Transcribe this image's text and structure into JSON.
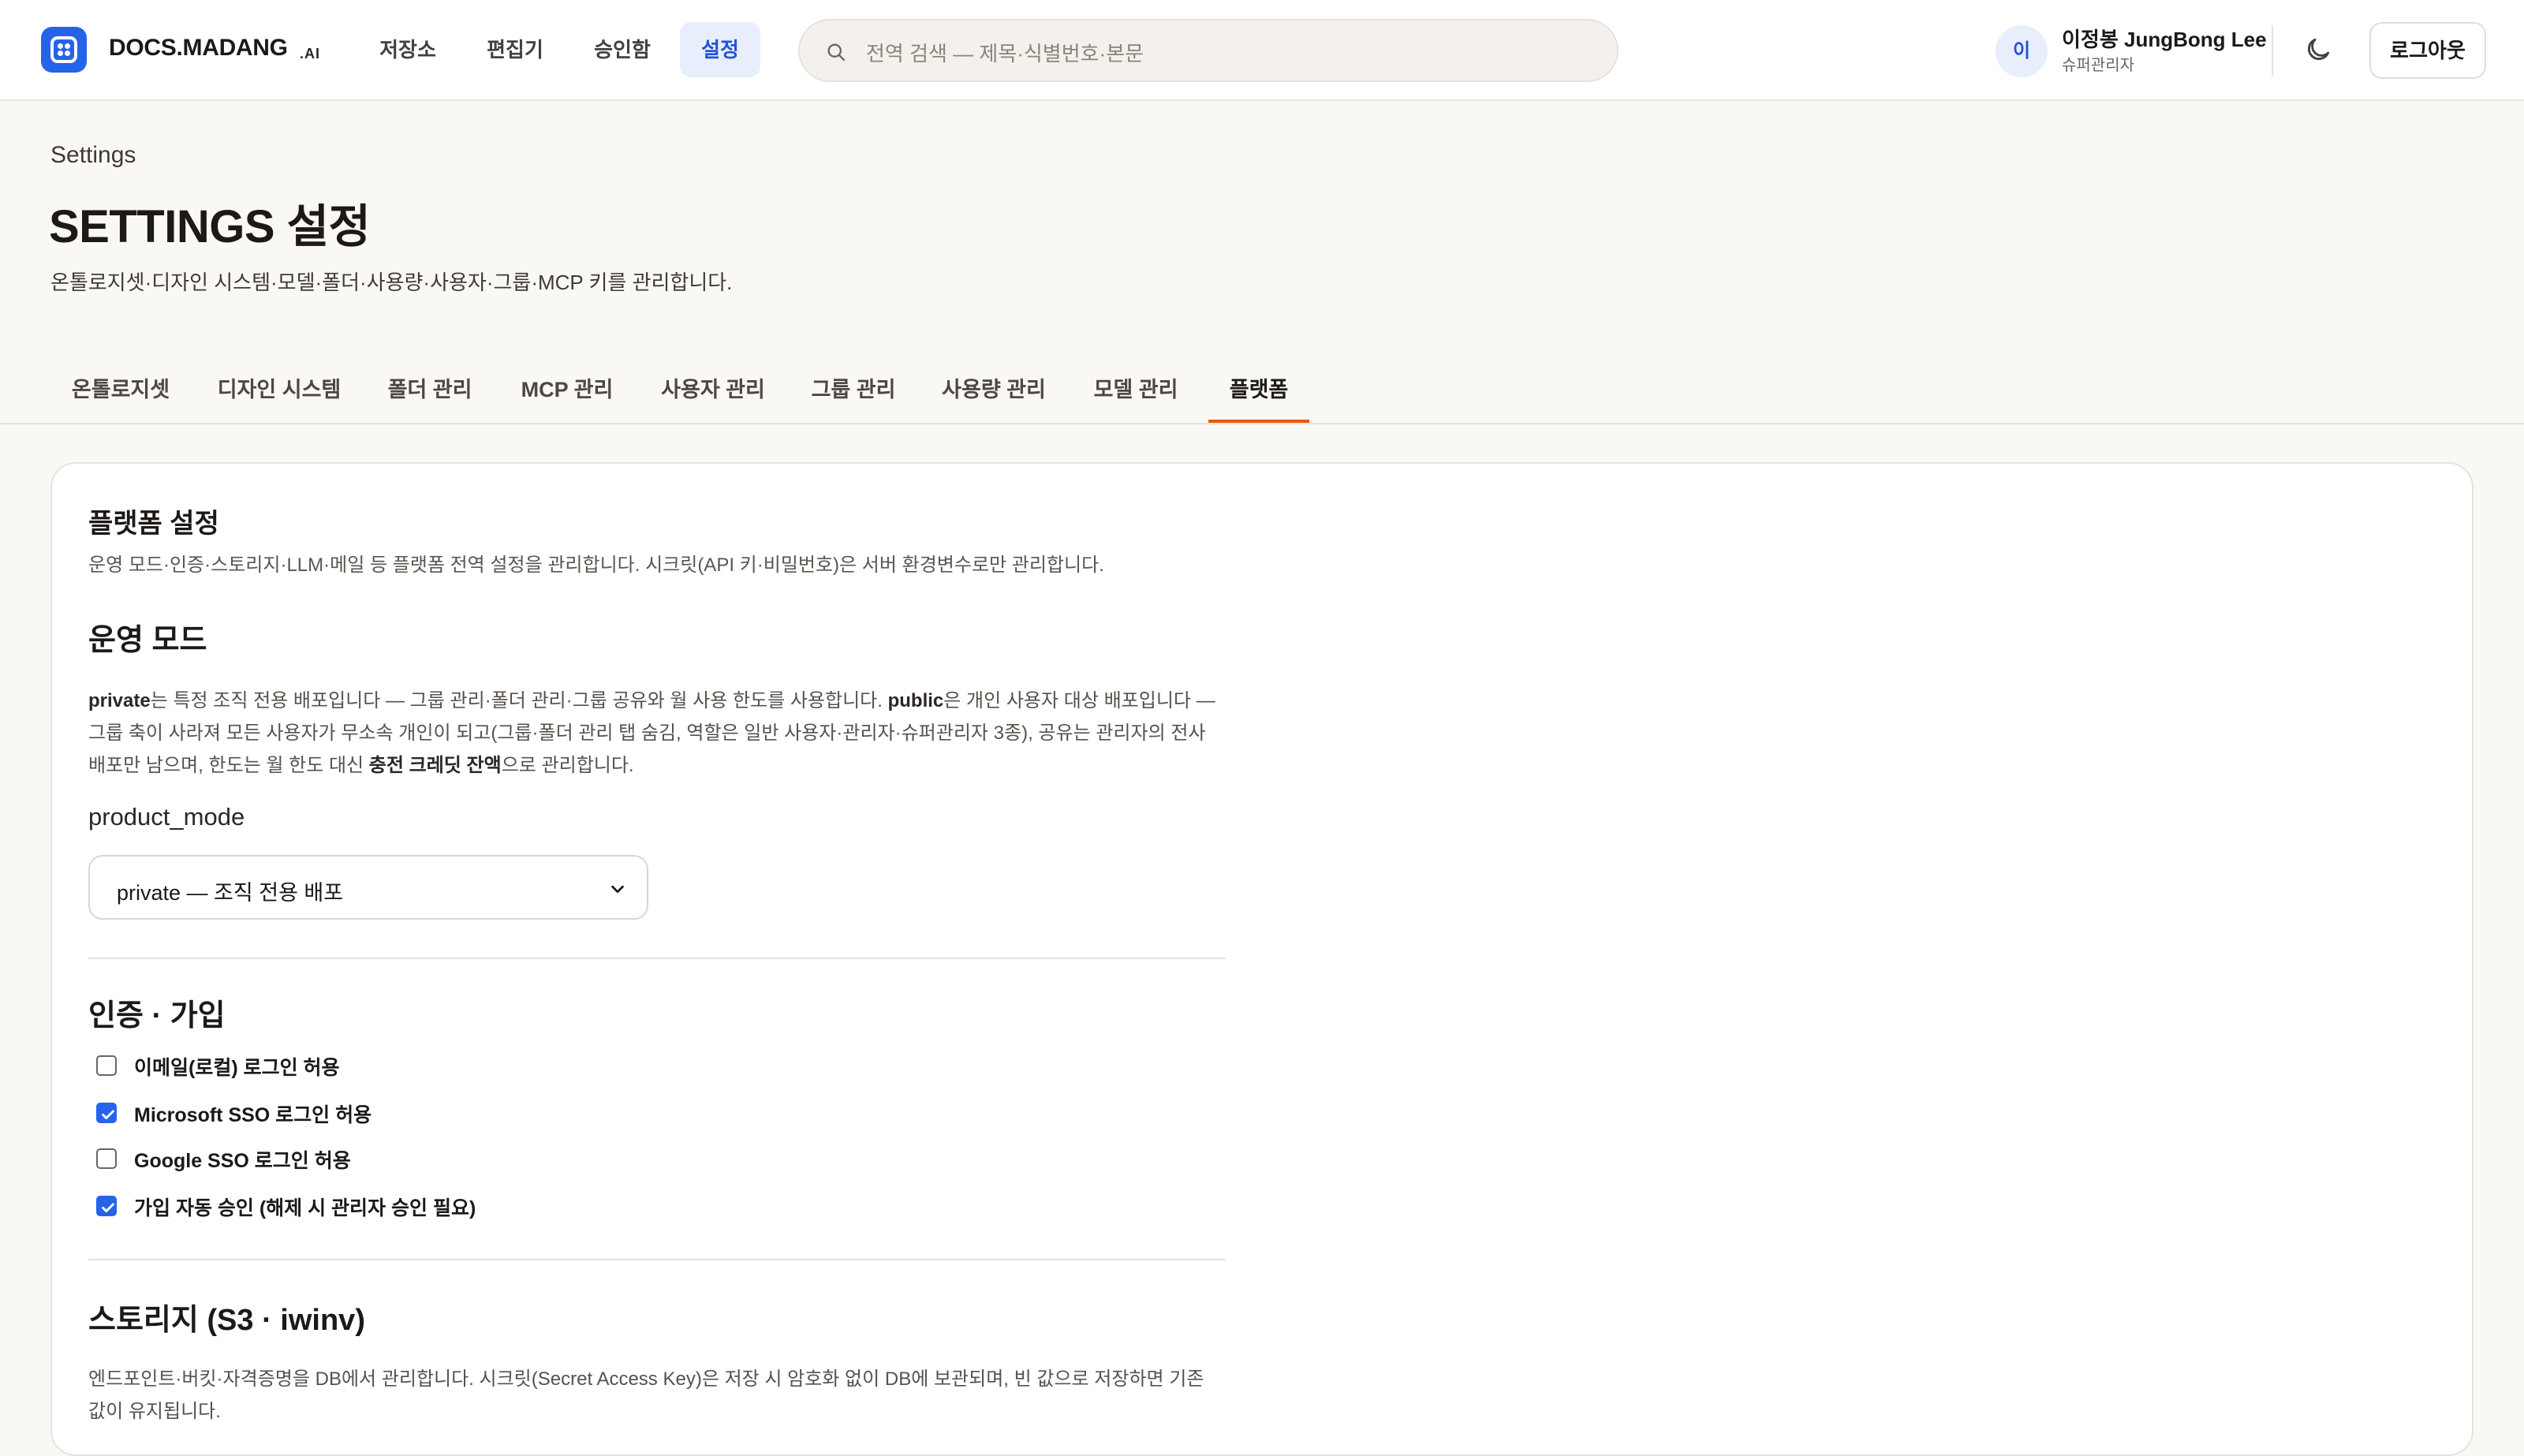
{
  "header": {
    "brand": "DOCS.MADANG",
    "brand_suffix": ".AI",
    "nav": [
      "저장소",
      "편집기",
      "승인함",
      "설정"
    ],
    "active_nav": "설정",
    "search_placeholder": "전역 검색 — 제목·식별번호·본문",
    "user_initial": "이",
    "user_name": "이정봉 JungBong Lee",
    "user_role": "슈퍼관리자",
    "logout_label": "로그아웃",
    "accent_color": "#2563eb"
  },
  "page": {
    "breadcrumb": "Settings",
    "title": "SETTINGS 설정",
    "description": "온톨로지셋·디자인 시스템·모델·폴더·사용량·사용자·그룹·MCP 키를 관리합니다."
  },
  "tabs": [
    "온톨로지셋",
    "디자인 시스템",
    "폴더 관리",
    "MCP 관리",
    "사용자 관리",
    "그룹 관리",
    "사용량 관리",
    "모델 관리",
    "플랫폼"
  ],
  "active_tab": "플랫폼",
  "platform": {
    "title": "플랫폼 설정",
    "description": "운영 모드·인증·스토리지·LLM·메일 등 플랫폼 전역 설정을 관리합니다. 시크릿(API 키·비밀번호)은 서버 환경변수로만 관리합니다.",
    "mode": {
      "title": "운영 모드",
      "p1_b": "private",
      "p1_t": "는 특정 조직 전용 배포입니다 — 그룹 관리·폴더 관리·그룹 공유와 월 사용 한도를 사용합니다. ",
      "p2_b": "public",
      "p2_t": "은 개인 사용자 대상 배포입니다 — 그룹 축이 사라져 모든 사용자가 무소속 개인이 되고(그룹·폴더 관리 탭 숨김, 역할은 일반 사용자·관리자·슈퍼관리자 3종), 공유는 관리자의 전사 배포만 남으며, 한도는 월 한도 대신 ",
      "p3_b": "충전 크레딧 잔액",
      "p3_t": "으로 관리합니다.",
      "field_label": "product_mode",
      "selected": "private — 조직 전용 배포"
    },
    "auth": {
      "title": "인증 · 가입",
      "options": [
        {
          "label": "이메일(로컬) 로그인 허용",
          "checked": false
        },
        {
          "label": "Microsoft SSO 로그인 허용",
          "checked": true
        },
        {
          "label": "Google SSO 로그인 허용",
          "checked": false
        },
        {
          "label": "가입 자동 승인 (해제 시 관리자 승인 필요)",
          "checked": true
        }
      ]
    },
    "storage": {
      "title": "스토리지 (S3 · iwinv)",
      "description": "엔드포인트·버킷·자격증명을 DB에서 관리합니다. 시크릿(Secret Access Key)은 저장 시 암호화 없이 DB에 보관되며, 빈 값으로 저장하면 기존 값이 유지됩니다."
    }
  }
}
